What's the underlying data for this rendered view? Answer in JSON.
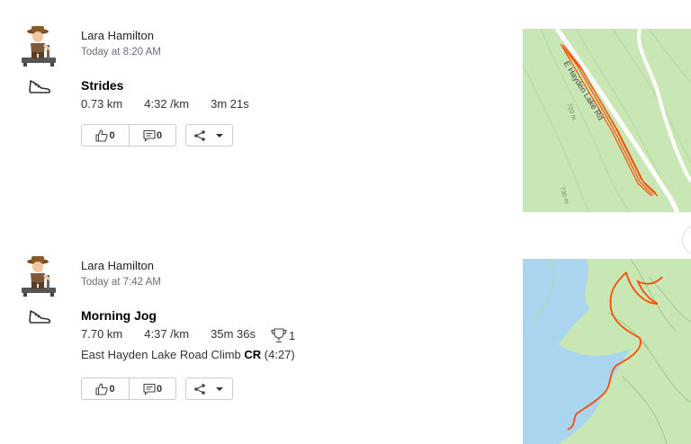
{
  "activities": [
    {
      "athlete": "Lara Hamilton",
      "timestamp": "Today at 8:20 AM",
      "sport_icon": "shoe-icon",
      "title": "Strides",
      "stats": {
        "distance": "0.73 km",
        "pace": "4:32 /km",
        "time": "3m 21s"
      },
      "kudos_count": "0",
      "comment_count": "0",
      "map": {
        "road_label": "E Hayden Lake Rd",
        "contour_1": "720 m",
        "contour_2": "730 m"
      }
    },
    {
      "athlete": "Lara Hamilton",
      "timestamp": "Today at 7:42 AM",
      "sport_icon": "shoe-icon",
      "title": "Morning Jog",
      "stats": {
        "distance": "7.70 km",
        "pace": "4:37 /km",
        "time": "35m 36s",
        "achievements": "1"
      },
      "segment": {
        "name": "East Hayden Lake Road Climb",
        "badge": "CR",
        "time": "(4:27)"
      },
      "kudos_count": "0",
      "comment_count": "0"
    }
  ],
  "colors": {
    "route": "#fc4c02",
    "map_green": "#c9e7b5",
    "water": "#a9d6ee"
  }
}
